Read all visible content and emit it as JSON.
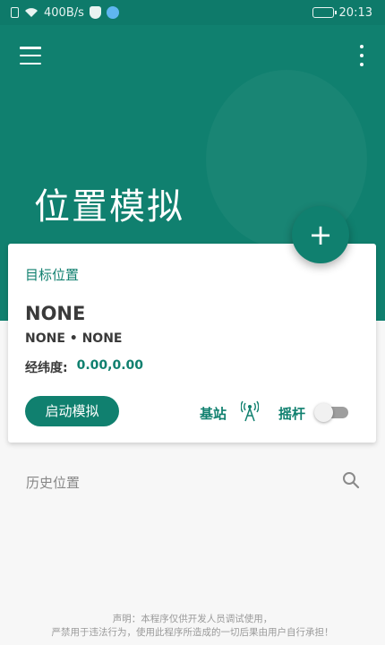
{
  "status_bar": {
    "network_speed": "400B/s",
    "time": "20:13",
    "icons": [
      "sim-icon",
      "wifi-icon",
      "shield-icon",
      "vpn-icon",
      "battery-icon"
    ]
  },
  "header": {
    "title": "位置模拟",
    "icons": [
      "menu-icon",
      "more-vert-icon"
    ]
  },
  "fab": {
    "label": "+"
  },
  "card": {
    "title": "目标位置",
    "location_name": "NONE",
    "location_sub": "NONE • NONE",
    "coord_label": "经纬度:",
    "coord_value": "0.00,0.00",
    "start_button": "启动模拟",
    "base_station_label": "基站",
    "joystick_label": "摇杆",
    "joystick_enabled": false
  },
  "history": {
    "label": "历史位置"
  },
  "disclaimer": {
    "line1": "声明：本程序仅供开发人员调试使用，",
    "line2": "严禁用于违法行为，使用此程序所造成的一切后果由用户自行承担！"
  },
  "colors": {
    "primary": "#10806f",
    "status_bar": "#0e7a6a",
    "background": "#f7f7f7"
  }
}
